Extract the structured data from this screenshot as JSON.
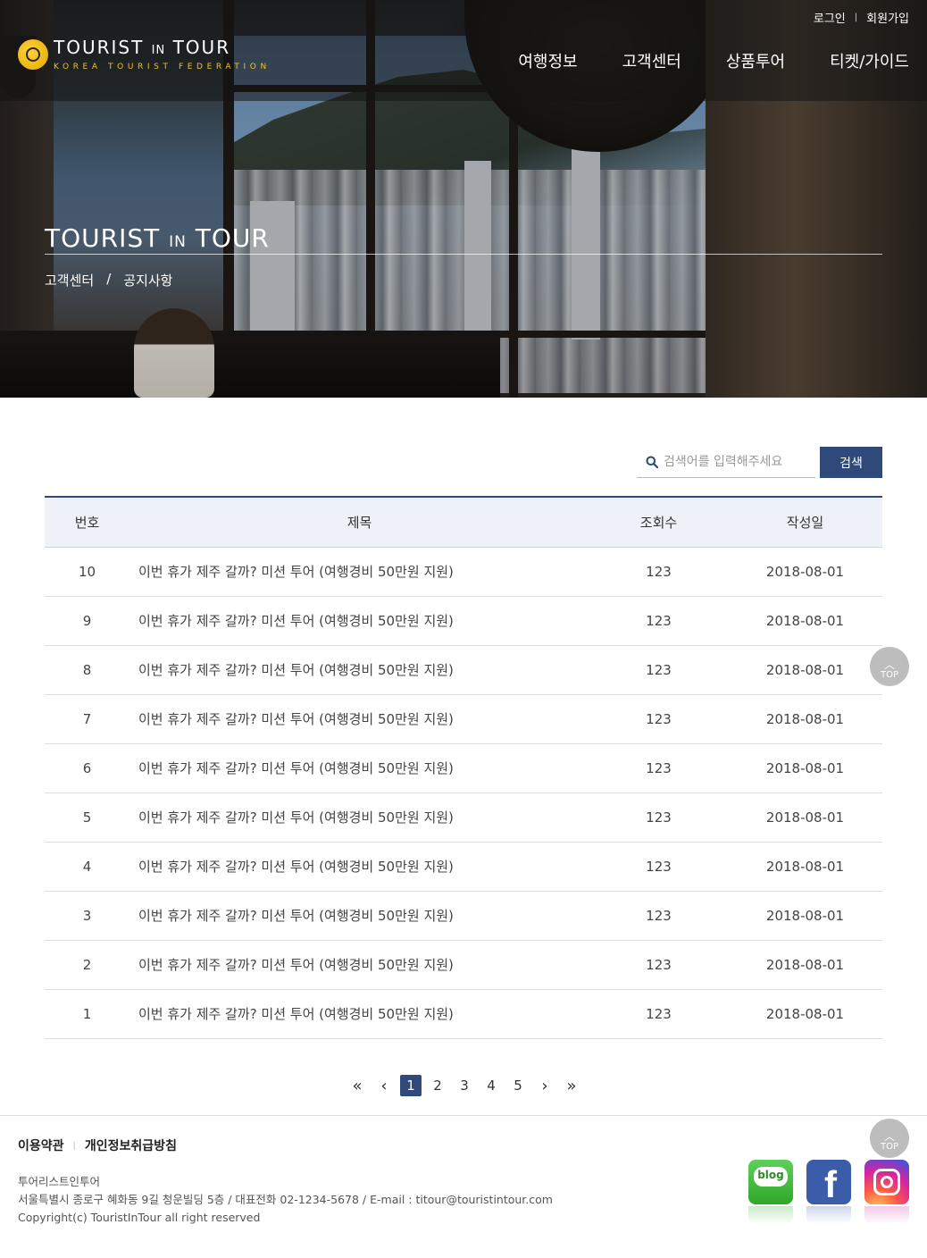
{
  "header": {
    "util": {
      "login": "로그인",
      "join": "회원가입"
    },
    "logo": {
      "main_a": "TOURIST",
      "main_in": "IN",
      "main_b": "TOUR",
      "sub": "KOREA TOURIST FEDERATION"
    },
    "nav": [
      "여행정보",
      "고객센터",
      "상품투어",
      "티켓/가이드"
    ]
  },
  "hero": {
    "title_a": "TOURIST",
    "title_in": "IN",
    "title_b": "TOUR",
    "breadcrumb": {
      "parent": "고객센터",
      "sep": "/",
      "current": "공지사항"
    }
  },
  "search": {
    "placeholder": "검색어를 입력해주세요",
    "button": "검색"
  },
  "table": {
    "headers": {
      "num": "번호",
      "title": "제목",
      "views": "조회수",
      "date": "작성일"
    },
    "rows": [
      {
        "num": "10",
        "title": "이번 휴가 제주 갈까? 미션 투어 (여행경비 50만원 지원)",
        "views": "123",
        "date": "2018-08-01"
      },
      {
        "num": "9",
        "title": "이번 휴가 제주 갈까? 미션 투어 (여행경비 50만원 지원)",
        "views": "123",
        "date": "2018-08-01"
      },
      {
        "num": "8",
        "title": "이번 휴가 제주 갈까? 미션 투어 (여행경비 50만원 지원)",
        "views": "123",
        "date": "2018-08-01"
      },
      {
        "num": "7",
        "title": "이번 휴가 제주 갈까? 미션 투어 (여행경비 50만원 지원)",
        "views": "123",
        "date": "2018-08-01"
      },
      {
        "num": "6",
        "title": "이번 휴가 제주 갈까? 미션 투어 (여행경비 50만원 지원)",
        "views": "123",
        "date": "2018-08-01"
      },
      {
        "num": "5",
        "title": "이번 휴가 제주 갈까? 미션 투어 (여행경비 50만원 지원)",
        "views": "123",
        "date": "2018-08-01"
      },
      {
        "num": "4",
        "title": "이번 휴가 제주 갈까? 미션 투어 (여행경비 50만원 지원)",
        "views": "123",
        "date": "2018-08-01"
      },
      {
        "num": "3",
        "title": "이번 휴가 제주 갈까? 미션 투어 (여행경비 50만원 지원)",
        "views": "123",
        "date": "2018-08-01"
      },
      {
        "num": "2",
        "title": "이번 휴가 제주 갈까? 미션 투어 (여행경비 50만원 지원)",
        "views": "123",
        "date": "2018-08-01"
      },
      {
        "num": "1",
        "title": "이번 휴가 제주 갈까? 미션 투어 (여행경비 50만원 지원)",
        "views": "123",
        "date": "2018-08-01"
      }
    ]
  },
  "pagination": {
    "first": "«",
    "prev": "‹",
    "pages": [
      "1",
      "2",
      "3",
      "4",
      "5"
    ],
    "current": "1",
    "next": "›",
    "last": "»"
  },
  "top_button": {
    "label": "TOP",
    "caret": "︿"
  },
  "footer": {
    "links": {
      "terms": "이용약관",
      "privacy": "개인정보취급방침"
    },
    "company": "투어리스트인투어",
    "address": "서울특별시 종로구 혜화동 9길 청운빌딩 5층 / 대표전화 02-1234-5678 / E-mail : titour@touristintour.com",
    "copyright": "Copyright(c) TouristInTour all right reserved",
    "social": {
      "blog": "blog",
      "facebook": "f"
    }
  },
  "colors": {
    "accent": "#2f4a7a",
    "header_bg": "#eef1f8",
    "gold": "#f2c21b"
  },
  "icons": [
    "search-icon",
    "blog-icon",
    "facebook-icon",
    "instagram-icon",
    "globe-logo-icon"
  ]
}
